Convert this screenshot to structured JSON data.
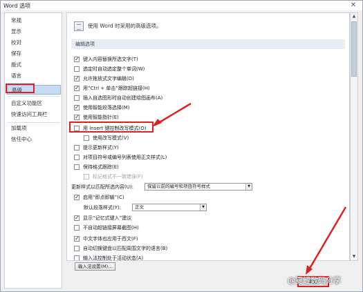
{
  "window": {
    "title": "Word 选项"
  },
  "sidebar": {
    "items": [
      {
        "label": "常规"
      },
      {
        "label": "显示"
      },
      {
        "label": "校对"
      },
      {
        "label": "保存"
      },
      {
        "label": "版式"
      },
      {
        "label": "语言"
      },
      {
        "label": "高级"
      },
      {
        "label": "自定义功能区"
      },
      {
        "label": "快速访问工具栏"
      },
      {
        "label": "加载项"
      },
      {
        "label": "信任中心"
      }
    ],
    "active": "高级"
  },
  "main": {
    "header": "使用 Word 时采用的高级选项。",
    "section": "编辑选项",
    "options": [
      {
        "label": "键入内容替换所选文字(T)",
        "checked": true
      },
      {
        "label": "选定时自动选定整个单词(W)",
        "checked": false
      },
      {
        "label": "允许拖放式文字编辑(D)",
        "checked": true
      },
      {
        "label": "用“Ctrl + 单击”跟踪超链接(H)",
        "checked": true
      },
      {
        "label": "插入自选图形时自动创建绘图画布(A)",
        "checked": false
      },
      {
        "label": "使用智能段落选择(M)",
        "checked": true
      },
      {
        "label": "使用智能指针(E)",
        "checked": true
      },
      {
        "label": "用 Insert 键控制改写模式(O)",
        "checked": false
      },
      {
        "label": "使用改写模式(V)",
        "checked": false
      },
      {
        "label": "提示更新样式(Y)",
        "checked": false
      },
      {
        "label": "对项目符号或编号列表使用正文样式(L)",
        "checked": false
      },
      {
        "label": "保持格式跟踪(E)",
        "checked": false
      },
      {
        "label": "标记格式不一致错误(F)",
        "checked": false
      }
    ],
    "update_style_label": "更新样式以匹配所选内容(U):",
    "update_style_value": "保留以前的编号和项目符号样式",
    "click_type": {
      "label": "启用“即点即输”(C)",
      "checked": true
    },
    "default_para_label": "默认段落样式(Y):",
    "default_para_value": "正文",
    "options2": [
      {
        "label": "显示“记忆式键入”建议",
        "checked": true
      },
      {
        "label": "不自动超链接屏幕截图(H)",
        "checked": false
      },
      {
        "label": "中文字体也应用于西文(F)",
        "checked": true
      },
      {
        "label": "自动切换键盘以匹配周围文字的语言(B)",
        "checked": false
      },
      {
        "label": "输入法控制处于活动状态(A)",
        "checked": false
      }
    ],
    "ime_button": "输入法设置(M)..."
  },
  "footer": {
    "ok": "确定",
    "watermark": "@夏鲤数码分享"
  },
  "colors": {
    "annotation": "#e02020",
    "active_nav": "#c5dcf3"
  }
}
